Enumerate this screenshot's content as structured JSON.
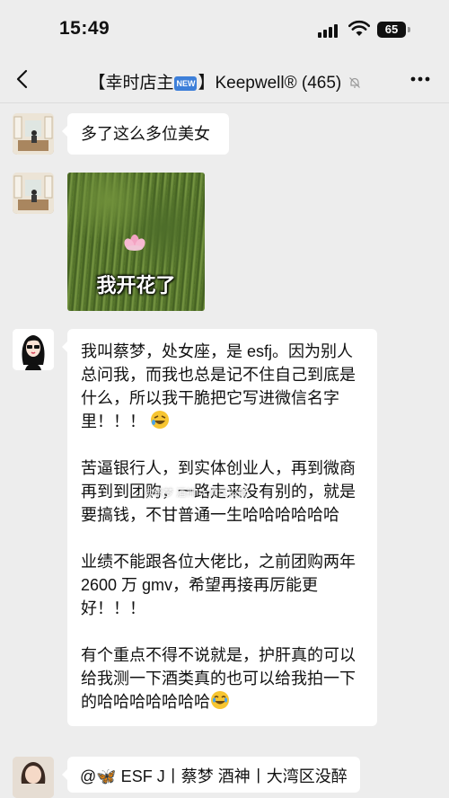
{
  "status": {
    "time": "15:49",
    "battery": "65"
  },
  "nav": {
    "title_prefix": "【幸时店主",
    "new_badge": "NEW",
    "title_suffix": "】Keepwell® (465)"
  },
  "messages": [
    {
      "type": "text",
      "text": "多了这么多位美女"
    },
    {
      "type": "sticker",
      "caption": "我开花了"
    },
    {
      "type": "text",
      "paragraphs": [
        "我叫蔡梦，处女座，是 esfj。因为别人总问我，而我也总是记不住自己到底是什么，所以我干脆把它写进微信名字里！！！",
        "苦逼银行人，到实体创业人，再到微商再到到团购，一路走来没有别的，就是要搞钱，不甘普通一生哈哈哈哈哈哈",
        "业绩不能跟各位大佬比，之前团购两年 2600 万 gmv，希望再接再厉能更好！！！",
        "有个重点不得不说就是，护肝真的可以给我测一下酒类真的也可以给我拍一下的哈哈哈哈哈哈哈"
      ]
    },
    {
      "type": "text",
      "text": "@🦋 ESF J丨蔡梦 酒神丨大湾区没醉"
    }
  ],
  "watermark": "@蔡梦 酒神 大湾区没醉",
  "icons": [
    "back-icon",
    "mute-icon",
    "more-icon",
    "rolling-laughing-emoji",
    "joy-emoji",
    "butterfly-emoji"
  ]
}
